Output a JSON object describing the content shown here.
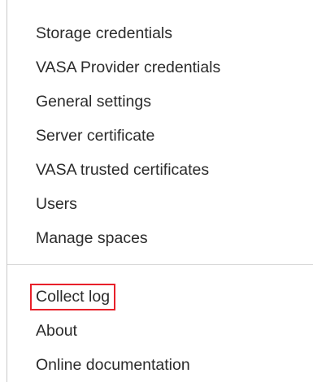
{
  "menu": {
    "primary_items": [
      "Storage credentials",
      "VASA Provider credentials",
      "General settings",
      "Server certificate",
      "VASA trusted certificates",
      "Users",
      "Manage spaces"
    ],
    "secondary_items": [
      "Collect log",
      "About",
      "Online documentation"
    ],
    "highlight_color": "#e8202a"
  }
}
